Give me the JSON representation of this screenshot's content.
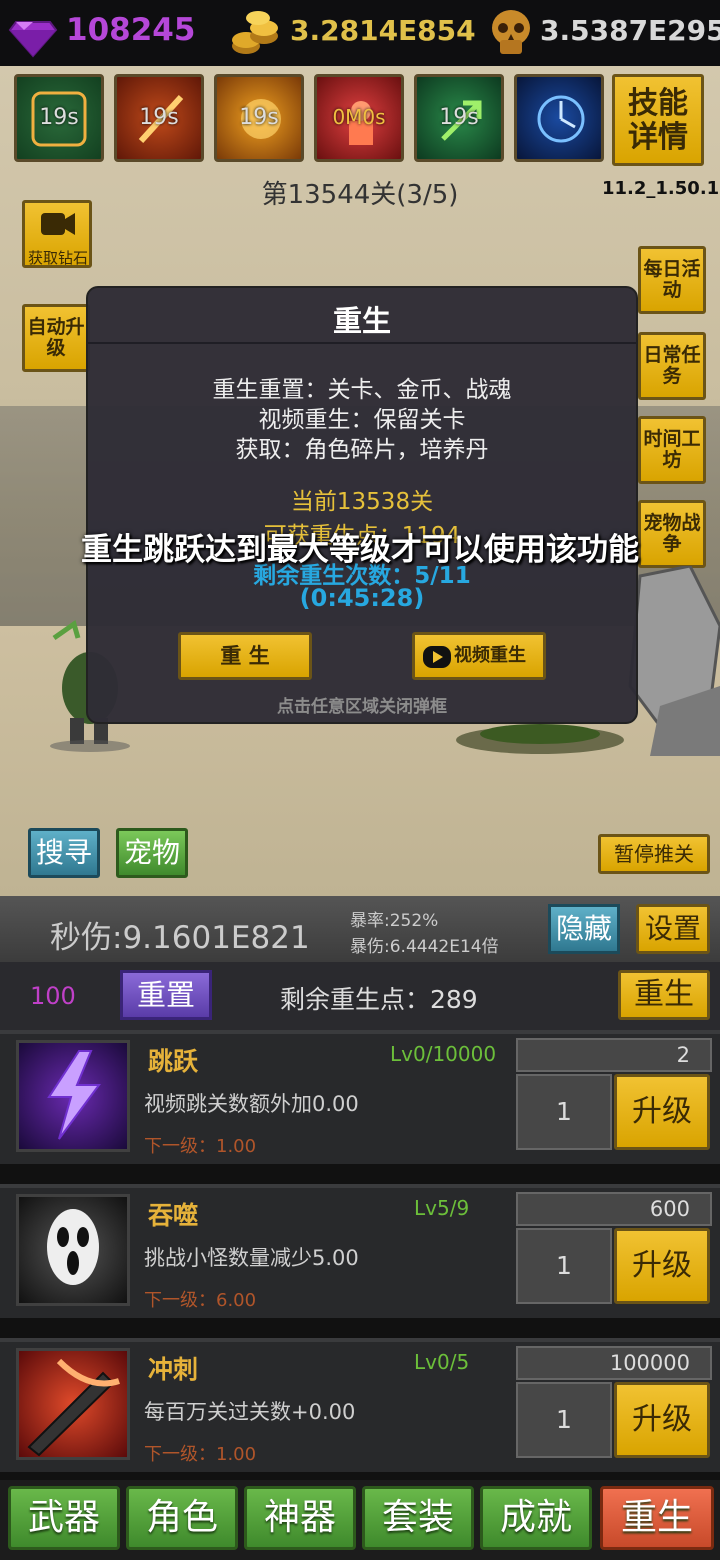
{
  "top": {
    "diamonds": "108245",
    "gold": "3.2814E854",
    "souls": "3.5387E295"
  },
  "skills": [
    {
      "icon": "green-frame-skill-icon",
      "cd": "19s"
    },
    {
      "icon": "fire-slash-skill-icon",
      "cd": "19s"
    },
    {
      "icon": "golden-burst-skill-icon",
      "cd": "19s"
    },
    {
      "icon": "red-power-skill-icon",
      "cd": "0M0s"
    },
    {
      "icon": "arrow-boost-skill-icon",
      "cd": "19s"
    },
    {
      "icon": "blue-clock-skill-icon",
      "cd": ""
    }
  ],
  "skill_details": "技能详情",
  "stage": "第13544关(3/5)",
  "version": "11.2_1.50.1",
  "get_diamond": "获取钻石",
  "auto_upgrade": "自动升级",
  "side_buttons": [
    "每日活动",
    "日常任务",
    "时间工坊",
    "宠物战争"
  ],
  "modal": {
    "title": "重生",
    "line1": "重生重置：关卡、金币、战魂",
    "line2": "视频重生：保留关卡",
    "line3": "获取：角色碎片，培养丹",
    "current": "当前13538关",
    "points": "可获重生点：1194",
    "remain": "剩余重生次数：5/11",
    "timer": "(0:45:28)",
    "btn_rebirth": "重 生",
    "btn_video": "视频重生",
    "close_hint": "点击任意区域关闭弹框"
  },
  "toast": "重生跳跃达到最大等级才可以使用该功能",
  "search": "搜寻",
  "pet": "宠物",
  "pause": "暂停推关",
  "stats": {
    "dps": "秒伤:9.1601E821",
    "crit_rate": "暴率:252%",
    "crit_dmg": "暴伤:6.4442E14倍",
    "hide": "隐藏",
    "settings": "设置"
  },
  "rebirth_bar": {
    "count": "100",
    "reset": "重置",
    "points_left": "剩余重生点：289",
    "rebirth": "重生"
  },
  "upgrades": [
    {
      "name": "跳跃",
      "level": "Lv0/10000",
      "desc": "视频跳关数额外加0.00",
      "next": "下一级：1.00",
      "cost": "2",
      "qty": "1",
      "btn": "升级",
      "icon": "purple-lightning-icon"
    },
    {
      "name": "吞噬",
      "level": "Lv5/9",
      "desc": "挑战小怪数量减少5.00",
      "next": "下一级：6.00",
      "cost": "600",
      "qty": "1",
      "btn": "升级",
      "icon": "ghost-mask-icon"
    },
    {
      "name": "冲刺",
      "level": "Lv0/5",
      "desc": "每百万关过关数+0.00",
      "next": "下一级：1.00",
      "cost": "100000",
      "qty": "1",
      "btn": "升级",
      "icon": "flaming-sword-icon"
    }
  ],
  "nav": [
    "武器",
    "角色",
    "神器",
    "套装",
    "成就",
    "重生"
  ]
}
